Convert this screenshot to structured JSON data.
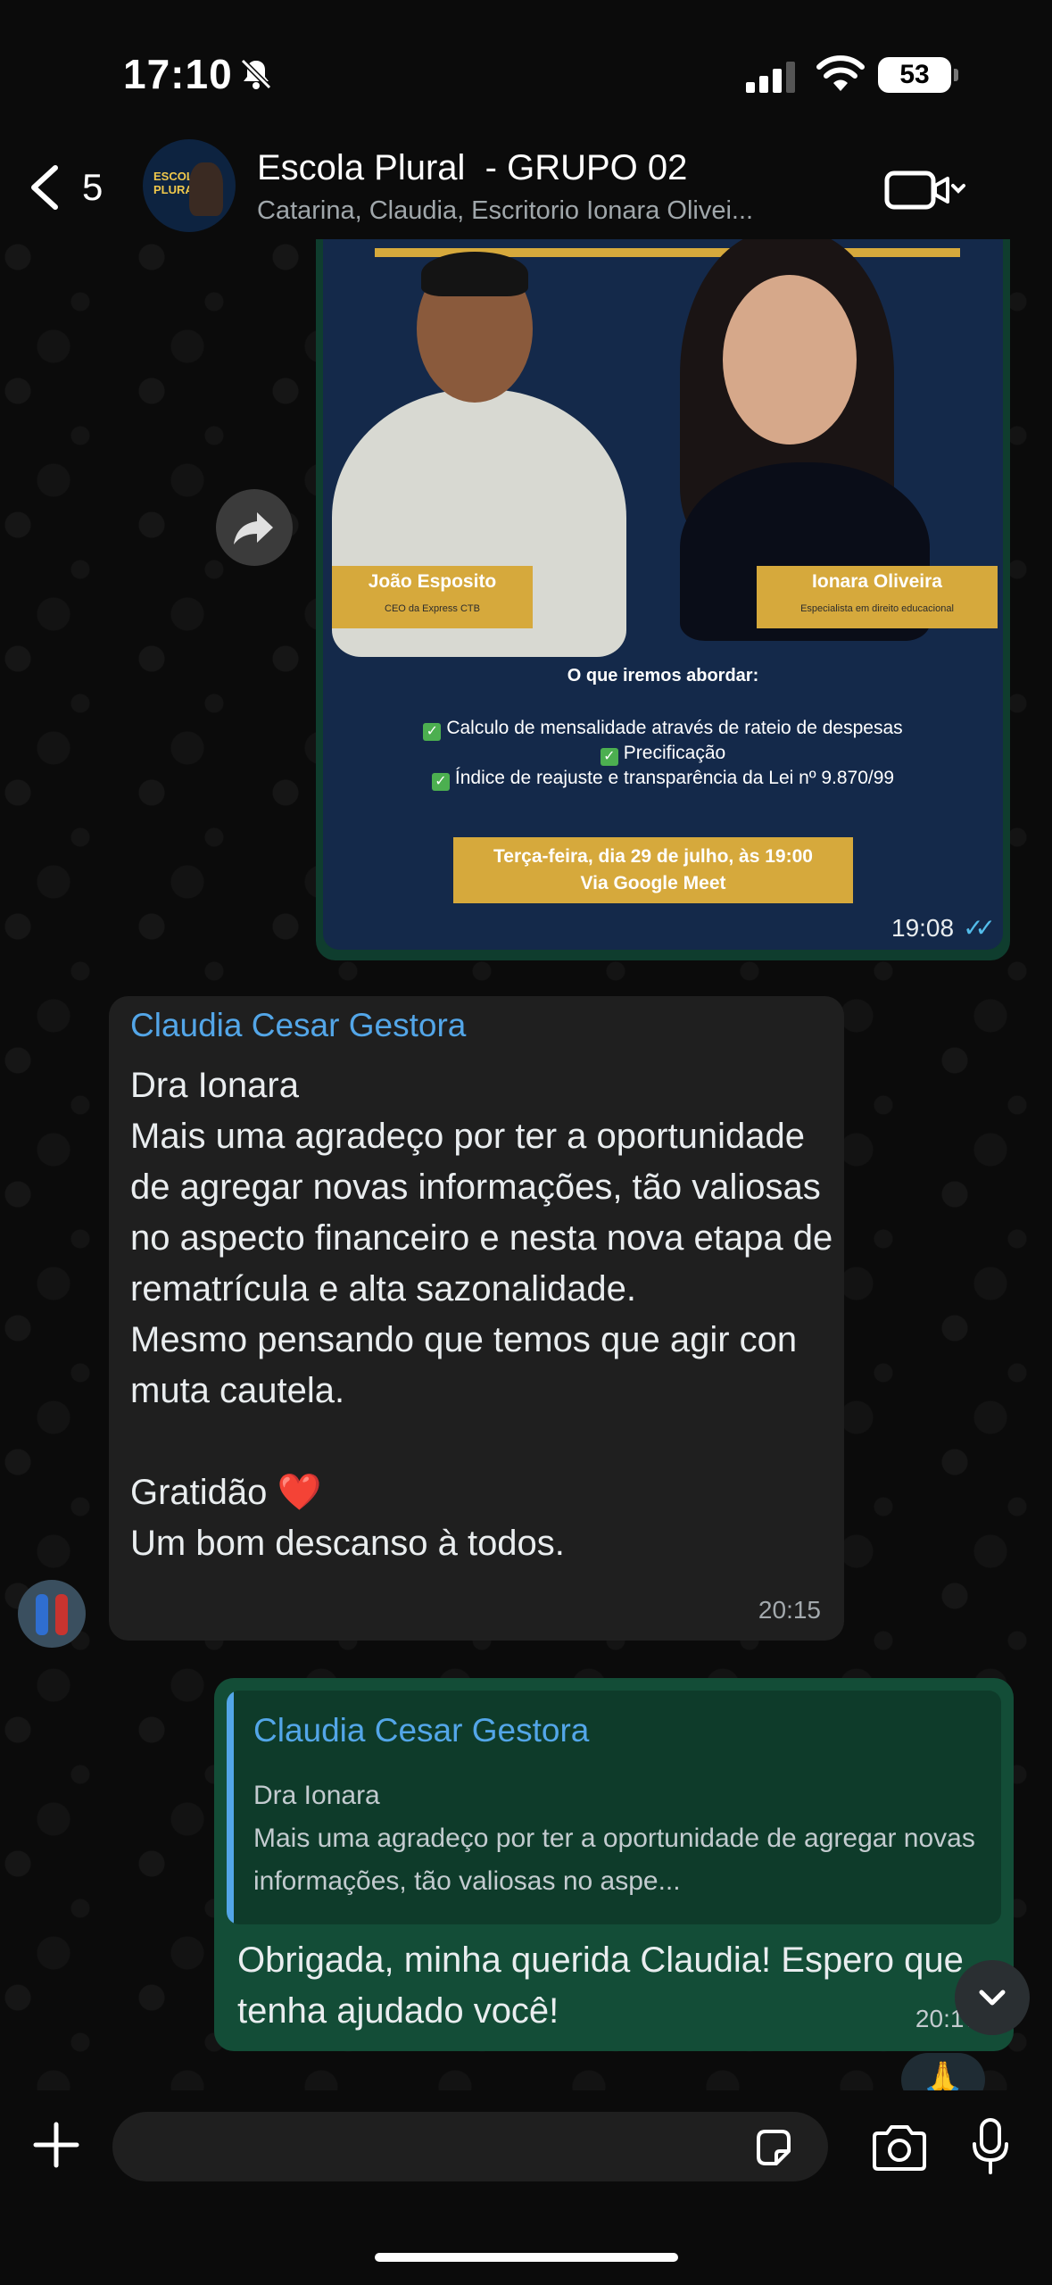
{
  "status_bar": {
    "time": "17:10",
    "battery": "53"
  },
  "header": {
    "back_count": "5",
    "title": "Escola Plural  - GRUPO 02",
    "subtitle": "Catarina, Claudia, Escritorio Ionara Olivei...",
    "avatar_text": "ESCOLA PLURAL"
  },
  "image_message": {
    "speaker1_name": "João Esposito",
    "speaker1_role": "CEO da Express CTB",
    "speaker2_name": "Ionara Oliveira",
    "speaker2_role": "Especialista em direito educacional",
    "heading": "O que iremos abordar:",
    "topics": [
      "Calculo de mensalidade através de rateio de despesas",
      "Precificação",
      "Índice de reajuste e transparência da Lei nº 9.870/99"
    ],
    "date_line1": "Terça-feira, dia 29 de julho, às 19:00",
    "date_line2": "Via Google Meet",
    "time": "19:08"
  },
  "incoming_message": {
    "sender": "Claudia Cesar Gestora",
    "text": "Dra Ionara\nMais uma agradeço por ter a oportunidade de agregar novas informações, tão valiosas no aspecto financeiro e nesta nova etapa de rematrícula e alta sazonalidade.\nMesmo pensando que temos que agir con muta cautela.\n\nGratidão ",
    "heart": "❤️",
    "last_line": "Um bom descanso à todos.",
    "time": "20:15"
  },
  "outgoing_message": {
    "quote_name": "Claudia Cesar Gestora",
    "quote_text": "Dra Ionara\nMais uma agradeço por ter a oportunidade de agregar novas informações, tão valiosas no aspe...",
    "text": "Obrigada, minha querida Claudia! Espero que tenha ajudado você!",
    "time": "20:17",
    "reaction": "🙏"
  },
  "composer": {
    "placeholder": ""
  },
  "colors": {
    "outgoing": "#134d37",
    "incoming": "#1f1f1f",
    "accent_name": "#53a6e8",
    "poster_gold": "#d6a93c"
  },
  "icons": [
    "bell-slash-icon",
    "signal-icon",
    "wifi-icon",
    "back-chevron-icon",
    "video-call-icon",
    "forward-icon",
    "scroll-down-icon",
    "plus-icon",
    "sticker-icon",
    "camera-icon",
    "mic-icon"
  ]
}
